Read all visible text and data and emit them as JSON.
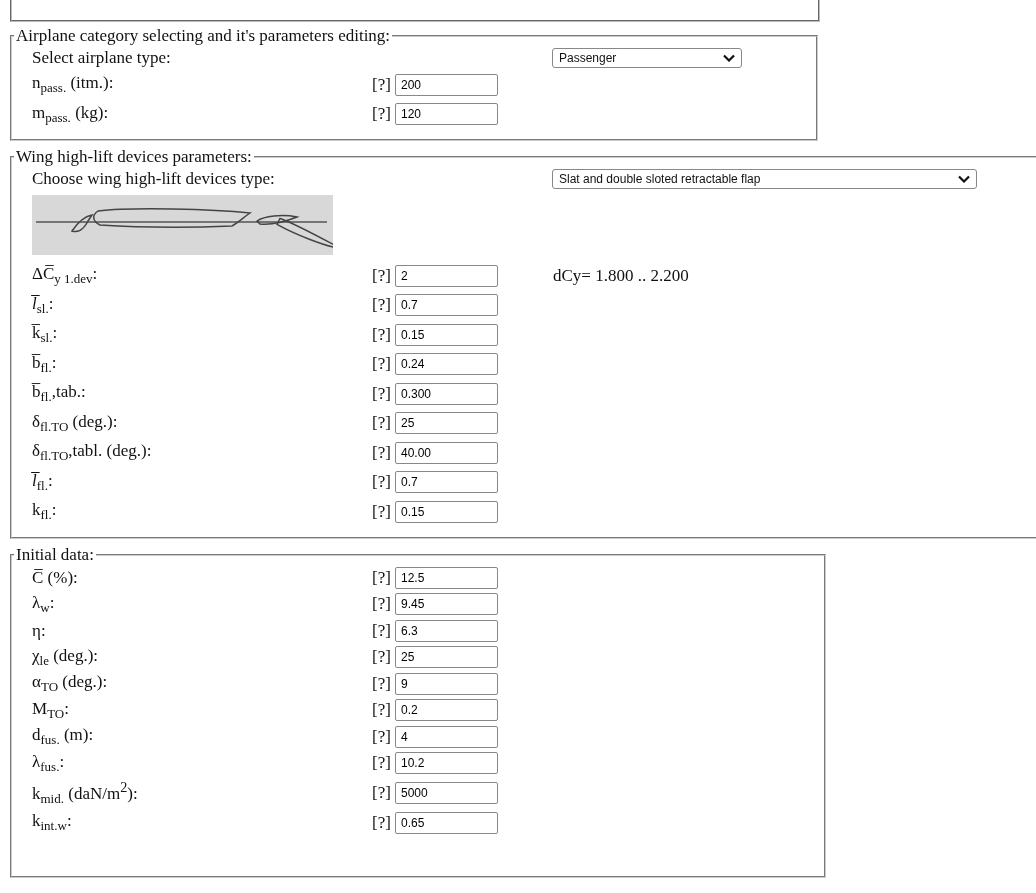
{
  "sections": [
    {
      "legend": "Airplane category selecting and it's parameters editing:",
      "select": {
        "label": "Select airplane type:",
        "value": "Passenger"
      },
      "rows": [
        {
          "label": "n$_{pass.}$ (itm.):",
          "help": "[?]",
          "value": "200"
        },
        {
          "label": "m$_{pass.}$ (kg):",
          "help": "[?]",
          "value": "120"
        }
      ]
    },
    {
      "legend": "Wing high-lift devices parameters:",
      "select": {
        "label": "Choose wing high-lift devices type:",
        "value": "Slat and double sloted retractable flap"
      },
      "figure": {
        "kind": "picture"
      },
      "rows": [
        {
          "label": "ΔC̅$_{y 1.dev}$:",
          "help": "[?]",
          "value": "2",
          "note": "dCy= 1.800 .. 2.200"
        },
        {
          "label": "*l̅*$_{sl.}$:",
          "help": "[?]",
          "value": "0.7"
        },
        {
          "label": "k̅$_{sl.}$:",
          "help": "[?]",
          "value": "0.15"
        },
        {
          "label": "b̅$_{fl.}$:",
          "help": "[?]",
          "value": "0.24"
        },
        {
          "label": "b̅$_{fl.}$,tab.:",
          "help": "[?]",
          "value": "0.300"
        },
        {
          "label": "δ$_{fl.TO}$ (deg.):",
          "help": "[?]",
          "value": "25"
        },
        {
          "label": "δ$_{fl.TO}$,tabl. (deg.):",
          "help": "[?]",
          "value": "40.00"
        },
        {
          "label": "*l̅*$_{fl.}$:",
          "help": "[?]",
          "value": "0.7"
        },
        {
          "label": "k$_{fl.}$:",
          "help": "[?]",
          "value": "0.15"
        }
      ]
    },
    {
      "legend": "Initial data:",
      "rows": [
        {
          "label": "C̅ (%):",
          "help": "[?]",
          "value": "12.5"
        },
        {
          "label": "λ$_{w}$:",
          "help": "[?]",
          "value": "9.45"
        },
        {
          "label": "η:",
          "help": "[?]",
          "value": "6.3"
        },
        {
          "label": "χ$_{le}$ (deg.):",
          "help": "[?]",
          "value": "25"
        },
        {
          "label": "α$_{TO}$ (deg.):",
          "help": "[?]",
          "value": "9"
        },
        {
          "label": "M$_{TO}$:",
          "help": "[?]",
          "value": "0.2"
        },
        {
          "label": "d$_{fus.}$ (m):",
          "help": "[?]",
          "value": "4"
        },
        {
          "label": "λ$_{fus.}$:",
          "help": "[?]",
          "value": "10.2"
        },
        {
          "label": "k$_{mid.}$ (daN/m$^{2}$):",
          "help": "[?]",
          "value": "5000"
        },
        {
          "label": "k$_{int.w}$:",
          "help": "[?]",
          "value": "0.65"
        }
      ]
    }
  ]
}
